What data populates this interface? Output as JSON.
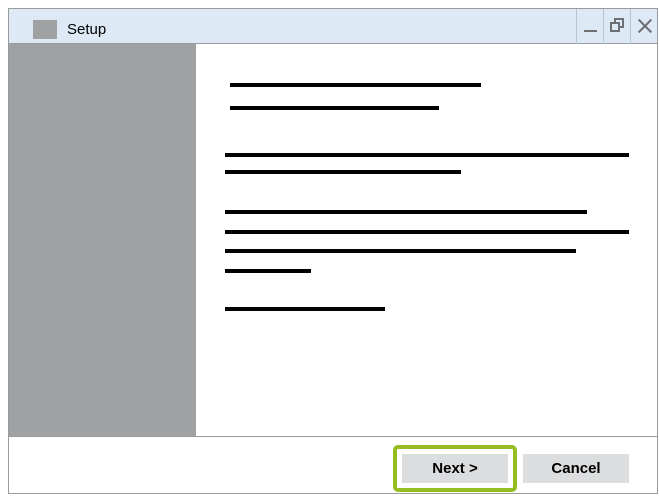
{
  "window": {
    "title": "Setup",
    "controls": {
      "minimize_icon": "minimize-icon",
      "maximize_icon": "restore-icon",
      "close_icon": "close-icon"
    }
  },
  "colors": {
    "titlebar": "#dde9f5",
    "sidebar": "#a0a1a3",
    "button": "#dcdddf",
    "highlight": "#96bd1f"
  },
  "footer": {
    "next_label": "Next >",
    "cancel_label": "Cancel"
  }
}
